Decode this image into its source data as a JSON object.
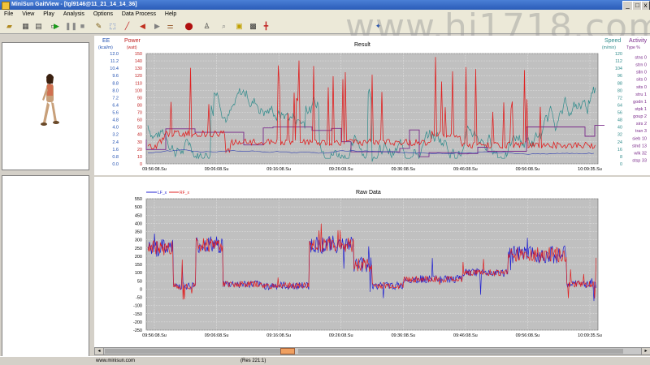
{
  "window": {
    "title": "MiniSun GaitView - [tgl9146@11_21_14_14_36]"
  },
  "menu": [
    "File",
    "View",
    "Play",
    "Analysis",
    "Options",
    "Data Process",
    "Help"
  ],
  "watermark": "www.hi1718.com",
  "chart1": {
    "title": "Result",
    "left_labels": {
      "ee": "EE",
      "ee_unit": "(kcal/m)",
      "power": "Power",
      "power_unit": "(watt)"
    },
    "right_labels": {
      "speed": "Speed",
      "speed_unit": "(m/min)",
      "activity": "Activity",
      "activity_unit": "Type %"
    },
    "ee_ticks": [
      "12.0",
      "11.2",
      "10.4",
      "9.6",
      "8.8",
      "8.0",
      "7.2",
      "6.4",
      "5.6",
      "4.8",
      "4.0",
      "3.2",
      "2.4",
      "1.6",
      "0.8",
      "0.0"
    ],
    "power_ticks": [
      "150",
      "140",
      "130",
      "120",
      "110",
      "100",
      "90",
      "80",
      "70",
      "60",
      "50",
      "40",
      "30",
      "20",
      "10",
      "0"
    ],
    "speed_ticks": [
      "120",
      "112",
      "104",
      "96",
      "88",
      "80",
      "72",
      "64",
      "56",
      "48",
      "40",
      "32",
      "24",
      "16",
      "8",
      "0"
    ],
    "activity_ticks": [
      "stns 0",
      "strn 0",
      "stln 0",
      "sits 0",
      "sits 0",
      "stru 1",
      "godn 1",
      "stpk 1",
      "goup 2",
      "sirs 2",
      "tran 3",
      "sieb 10",
      "stnd 13",
      "wlk 32",
      "stsp 33"
    ],
    "x_ticks": [
      "09:56:08.Su",
      "09:06:08.Su",
      "09:16:08.Su",
      "09:26:08.Su",
      "09:36:08.Su",
      "09:46:08.Su",
      "09:56:08.Su",
      "10:09:35.Su"
    ]
  },
  "chart2": {
    "title": "Raw Data",
    "legend": [
      "LF_x",
      "RF_x"
    ],
    "y_ticks": [
      "550",
      "500",
      "450",
      "400",
      "350",
      "300",
      "250",
      "200",
      "150",
      "100",
      "50",
      "0",
      "-50",
      "-100",
      "-150",
      "-200",
      "-250"
    ],
    "x_ticks": [
      "09:56:08.Su",
      "09:06:08.Su",
      "09:16:08.Su",
      "09:26:08.Su",
      "09:36:08.Su",
      "09:46:08.Su",
      "09:56:08.Su",
      "10:09:35.Su"
    ]
  },
  "status": {
    "website": "www.minisun.com",
    "res": "(Res 221:1)"
  },
  "colors": {
    "plot_bg": "#c0c0c0",
    "series_red": "#e02020",
    "series_blue": "#2020d0",
    "series_teal": "#2e8b8b",
    "series_purple": "#7a2a8a",
    "title_blue": "#1f4fb0"
  },
  "icons": [
    "open-icon",
    "save-icon",
    "print-icon",
    "export-icon",
    "play-icon",
    "pause-icon",
    "stop-icon",
    "tool-icon",
    "pen-icon",
    "back-icon",
    "forward-icon",
    "settings-icon",
    "user-icon",
    "zoom-icon",
    "grid-icon",
    "marker-icon"
  ]
}
